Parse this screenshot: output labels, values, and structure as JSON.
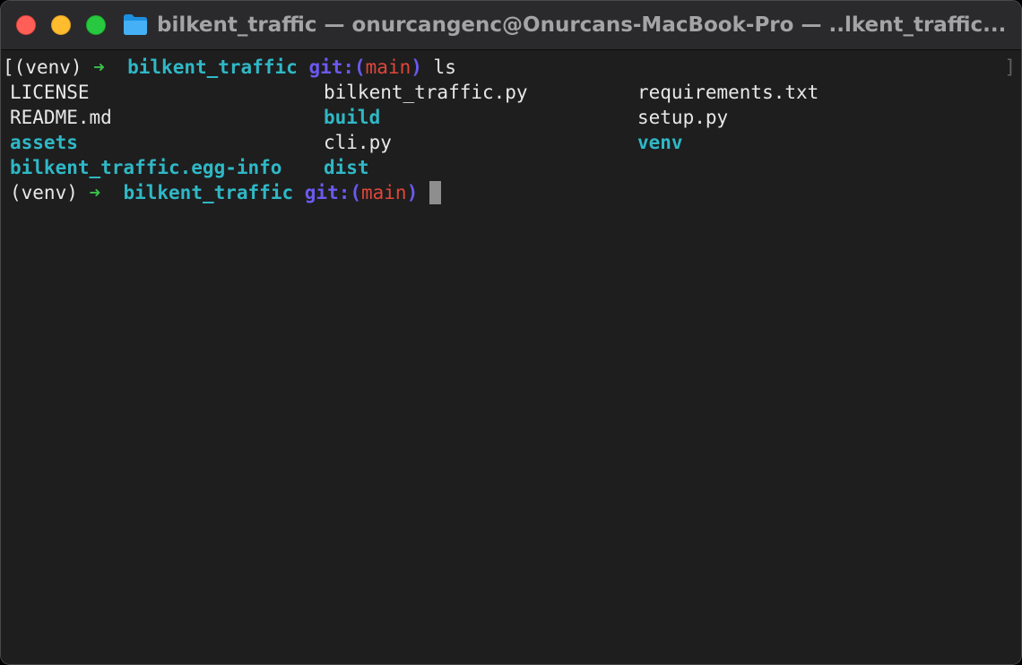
{
  "window": {
    "title": "bilkent_traffic — onurcangenc@Onurcans-MacBook-Pro — ..lkent_traffic..."
  },
  "icons": {
    "folder": "folder-icon",
    "arrow": "➜"
  },
  "colors": {
    "background": "#1e1e1e",
    "titlebar": "#2a2a2c",
    "cyan": "#2fb8c6",
    "green": "#3ac24a",
    "purple": "#6b59f0",
    "red": "#e0463a"
  },
  "prompt1": {
    "open_bracket": "[",
    "venv": "(venv)",
    "arrow": "➜",
    "dir": "bilkent_traffic",
    "git_open": "git:(",
    "branch": "main",
    "git_close": ")",
    "command": "ls"
  },
  "close_bracket": "]",
  "ls_output": [
    [
      "LICENSE",
      "bilkent_traffic.py",
      "requirements.txt"
    ],
    [
      "README.md",
      "build",
      "setup.py"
    ],
    [
      "assets",
      "cli.py",
      "venv"
    ],
    [
      "bilkent_traffic.egg-info",
      "dist",
      ""
    ]
  ],
  "prompt2": {
    "venv": "(venv)",
    "arrow": "➜",
    "dir": "bilkent_traffic",
    "git_open": "git:(",
    "branch": "main",
    "git_close": ")"
  }
}
